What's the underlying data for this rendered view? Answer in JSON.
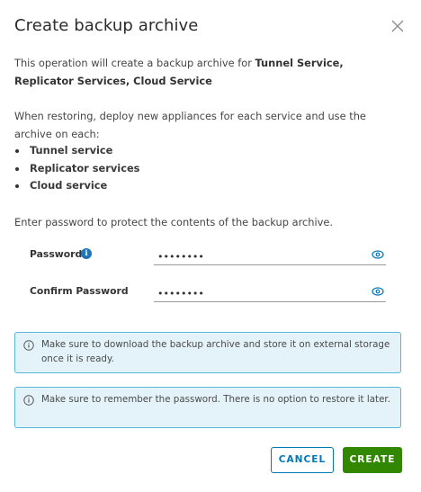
{
  "dialog": {
    "title": "Create backup archive"
  },
  "intro": {
    "prefix": "This operation will create a backup archive for ",
    "services_bold": "Tunnel Service, Replicator Services, Cloud Service"
  },
  "restore_text": "When restoring, deploy new appliances for each service and use the archive on each:",
  "services": [
    "Tunnel service",
    "Replicator services",
    "Cloud service"
  ],
  "enter_password_text": "Enter password to protect the contents of the backup archive.",
  "form": {
    "password_label": "Password",
    "password_value": "aaaaaaaa",
    "confirm_label": "Confirm Password",
    "confirm_value": "aaaaaaaa"
  },
  "alerts": [
    "Make sure to download the backup archive and store it on external storage once it is ready.",
    "Make sure to remember the password. There is no option to restore it later."
  ],
  "buttons": {
    "cancel": "CANCEL",
    "create": "CREATE"
  },
  "colors": {
    "primary": "#0079b8",
    "success": "#318700",
    "info_bg": "#e4f3f9",
    "info_border": "#58b7d9"
  }
}
